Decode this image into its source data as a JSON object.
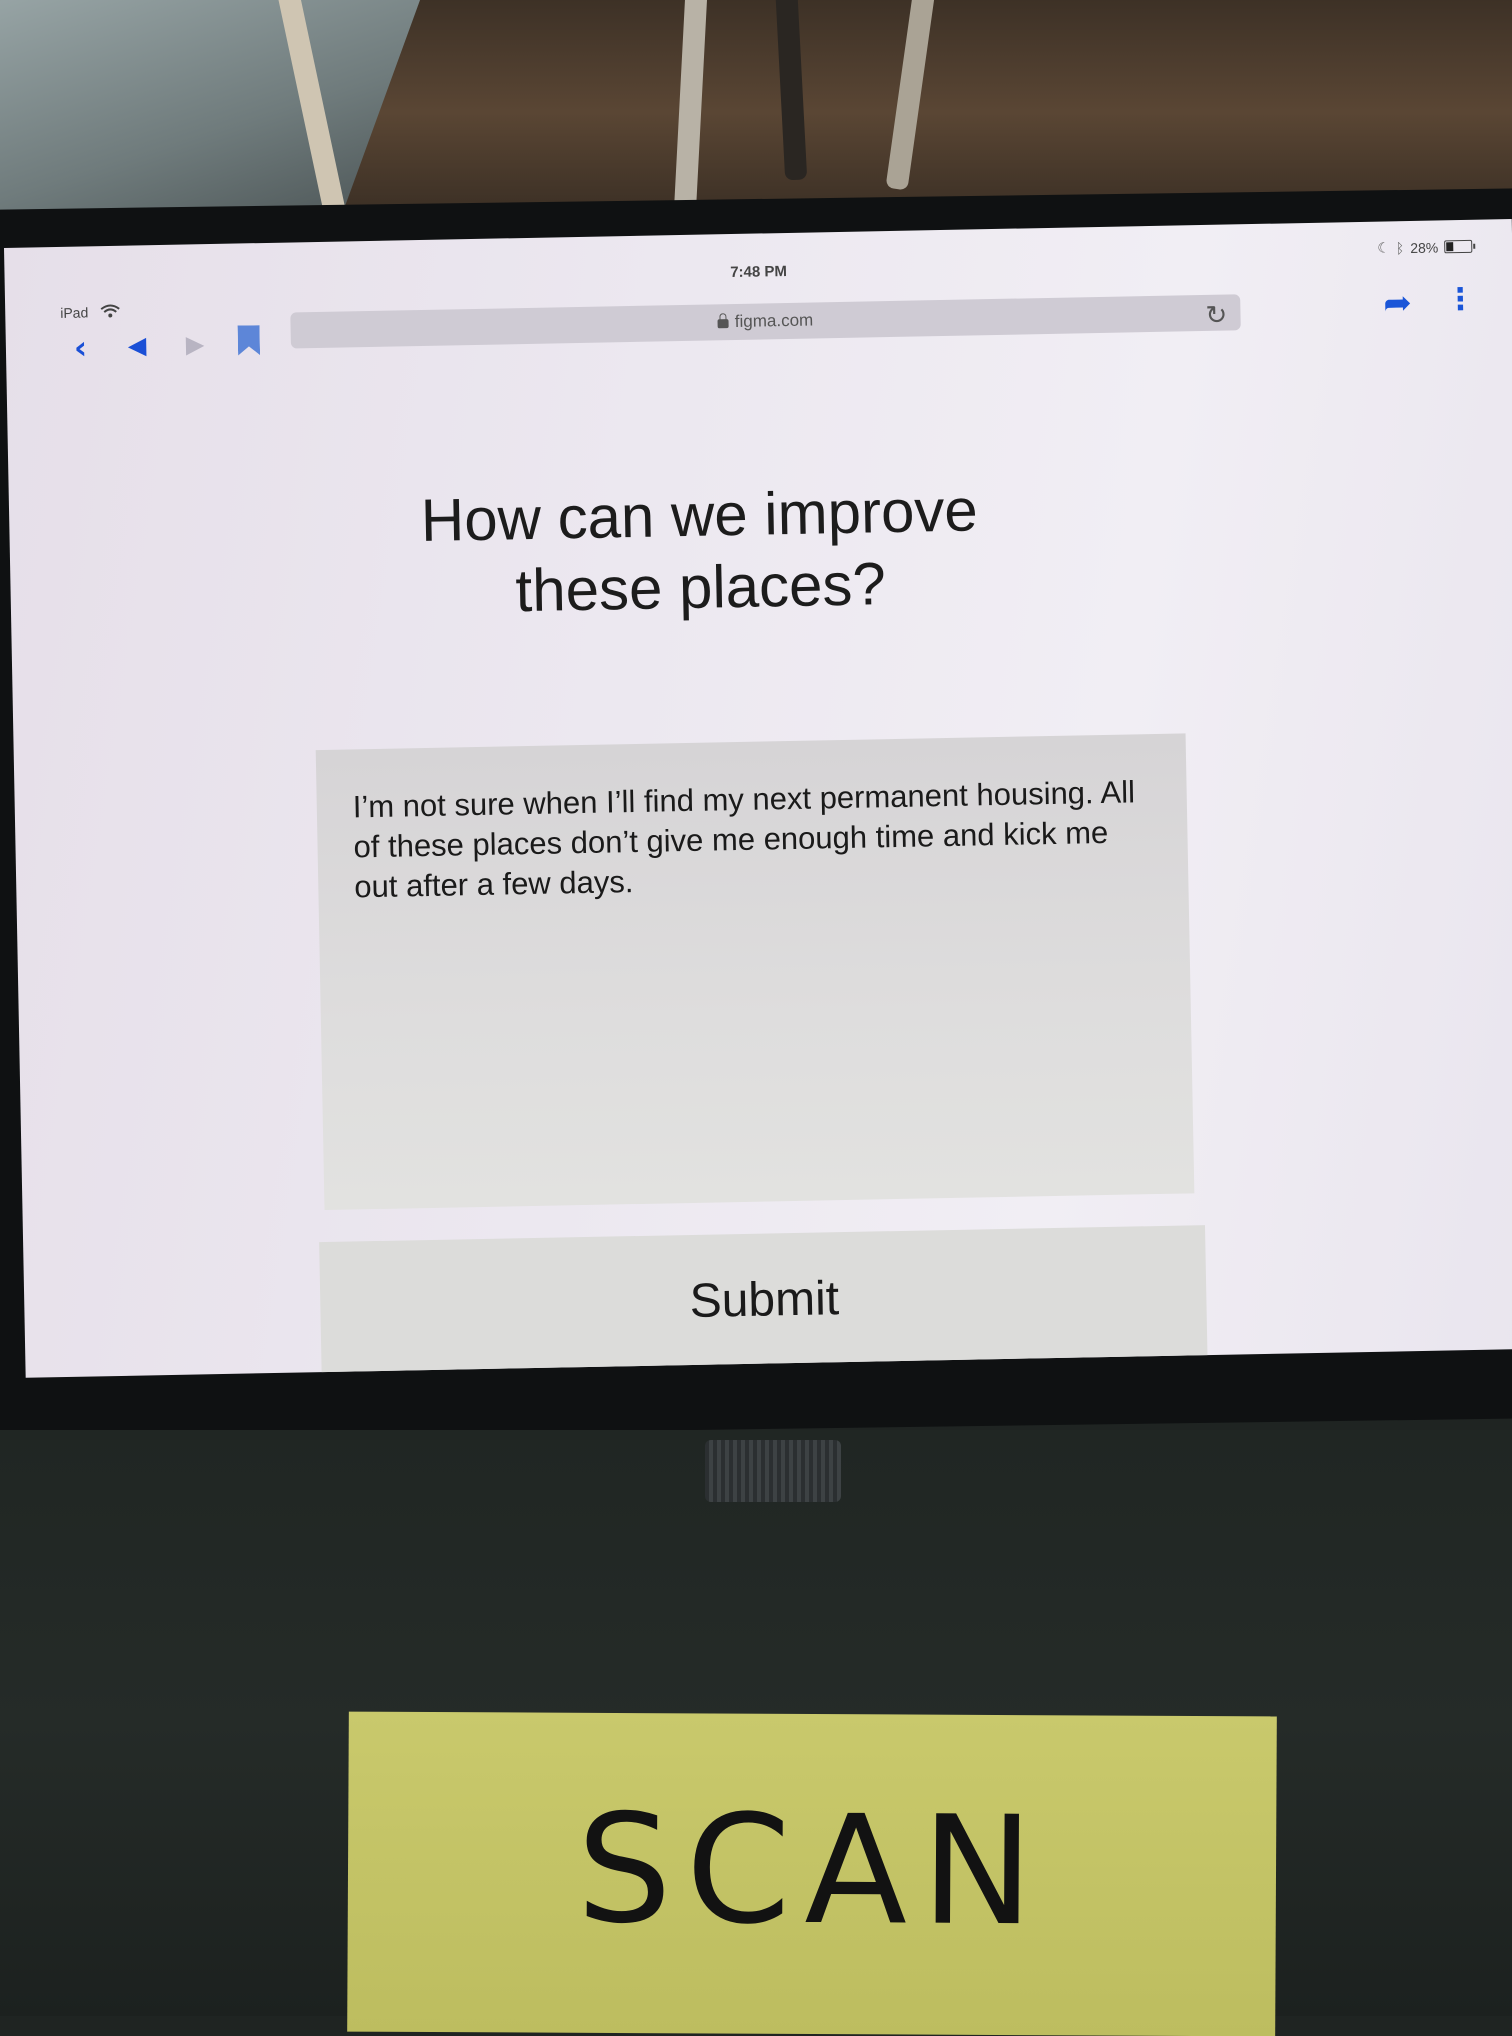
{
  "status_bar": {
    "device": "iPad",
    "time": "7:48 PM",
    "battery": "28%",
    "battery_level": 0.28
  },
  "browser": {
    "url": "figma.com",
    "icons": {
      "back": "chevron-left-icon",
      "previous": "triangle-left-icon",
      "next": "triangle-right-icon",
      "bookmarks": "bookmark-icon",
      "reload": "reload-icon",
      "share": "share-arrow-icon",
      "more": "vertical-ellipsis-icon"
    },
    "accent_color": "#1a55d8"
  },
  "page": {
    "title_line1": "How can we improve",
    "title_line2": "these places?",
    "feedback_text": "I’m not sure when I’ll find my next permanent housing. All of these places don’t give me enough time and kick me out after a few days.",
    "submit_label": "Submit"
  },
  "note": {
    "text": "SCAN",
    "color": "#c4c466"
  }
}
